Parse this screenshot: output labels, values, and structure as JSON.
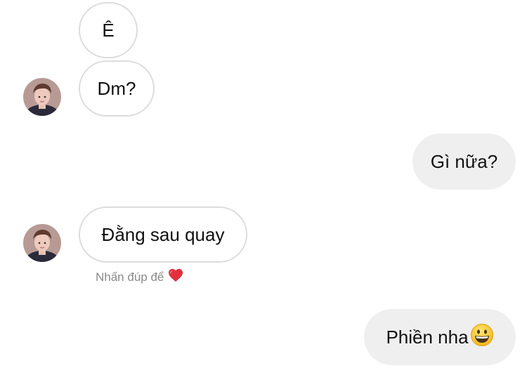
{
  "conversation": {
    "messages": [
      {
        "from": "them",
        "text": "Ê"
      },
      {
        "from": "them",
        "text": "Dm?"
      },
      {
        "from": "me",
        "text": "Gì nữa?"
      },
      {
        "from": "them",
        "text": "Đằng sau quay"
      },
      {
        "from": "me",
        "text": "Phiền nha"
      }
    ],
    "reaction_hint": "Nhấn đúp để",
    "reaction_hint_icon": "heart-icon",
    "last_message_emoji": "grinning-face-icon",
    "colors": {
      "sent_bubble": "#efefef",
      "received_border": "#dcdcdc",
      "hint_text": "#8a8a8a",
      "heart": "#e0303e"
    }
  }
}
